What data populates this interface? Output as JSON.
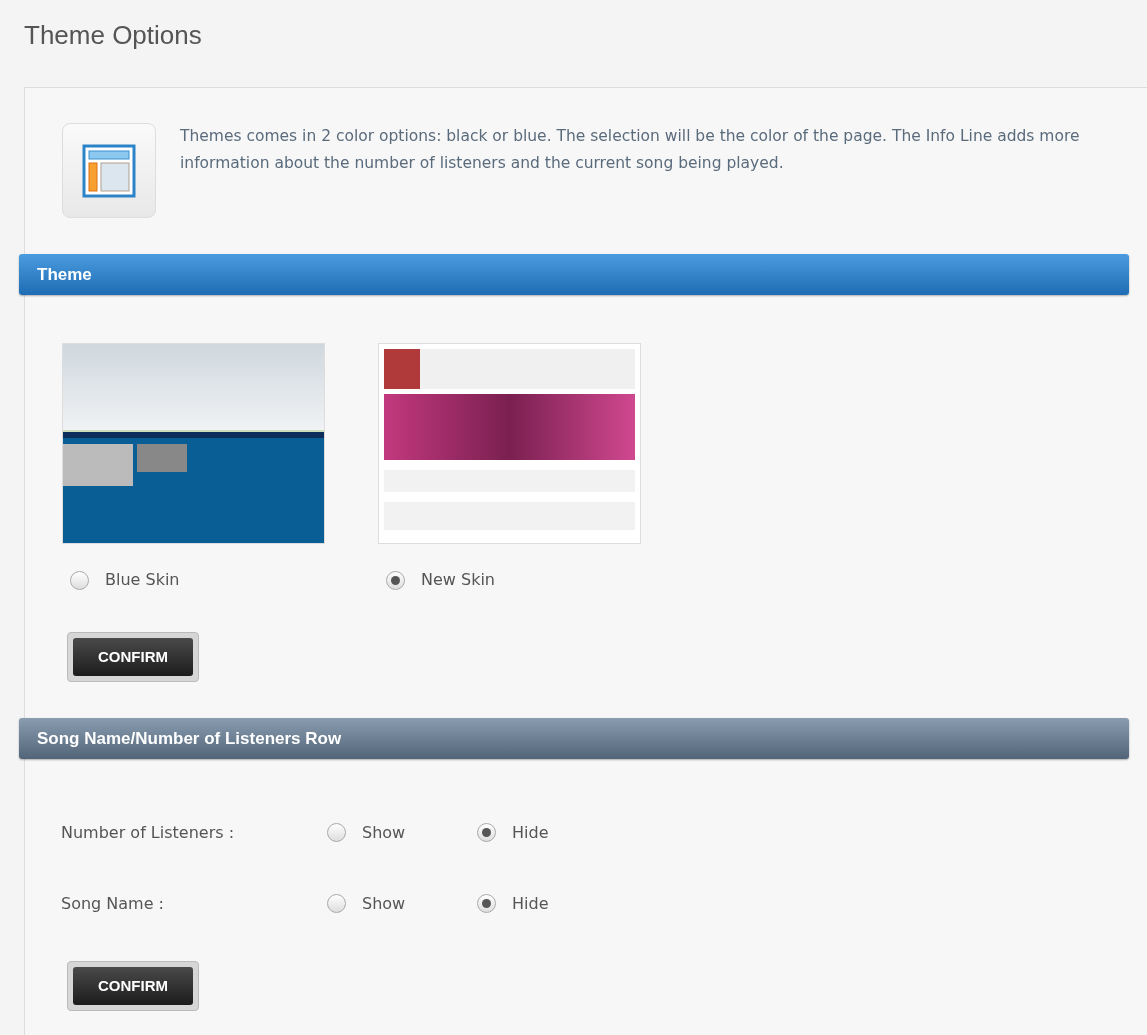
{
  "page_title": "Theme Options",
  "intro": "Themes comes in 2 color options: black or blue. The selection will be the color of the page. The Info Line adds more information about the number of listeners and the current song being played.",
  "sections": [
    {
      "kind": "skins",
      "title": "Theme",
      "skins": [
        {
          "label": "Blue Skin",
          "selected": false
        },
        {
          "label": "New Skin",
          "selected": true
        }
      ],
      "button": "CONFIRM"
    },
    {
      "kind": "options",
      "title": "Song Name/Number of Listeners Row",
      "rows": [
        {
          "label": "Number of Listeners :",
          "choices": [
            {
              "label": "Show",
              "selected": false
            },
            {
              "label": "Hide",
              "selected": true
            }
          ]
        },
        {
          "label": "Song Name :",
          "choices": [
            {
              "label": "Show",
              "selected": false
            },
            {
              "label": "Hide",
              "selected": true
            }
          ]
        }
      ],
      "button": "CONFIRM"
    }
  ]
}
